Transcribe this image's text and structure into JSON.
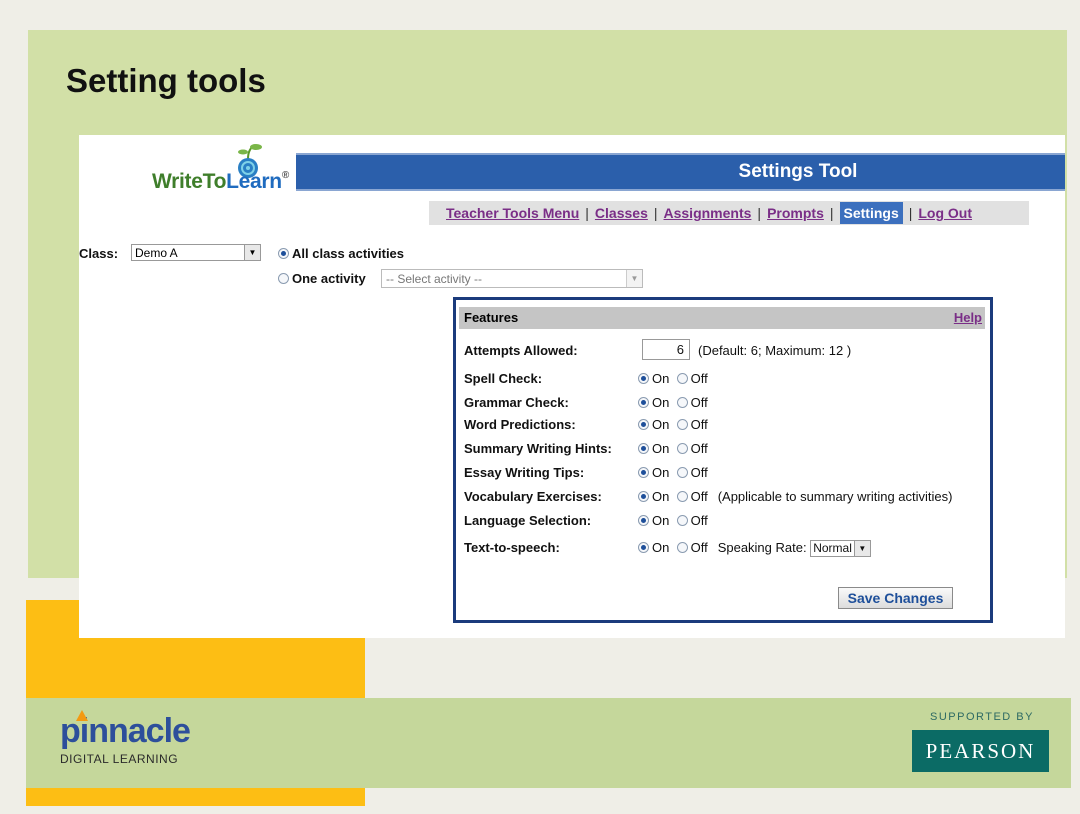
{
  "slide": {
    "title": "Setting tools"
  },
  "app": {
    "logo_prefix": "WriteTo",
    "logo_accent": "Learn",
    "logo_reg": "®",
    "page_title": "Settings Tool"
  },
  "nav": {
    "items": [
      "Teacher Tools Menu",
      "Classes",
      "Assignments",
      "Prompts",
      "Settings",
      "Log Out"
    ],
    "active": "Settings",
    "separator": "|"
  },
  "class_row": {
    "label": "Class:",
    "selected": "Demo A",
    "all_activities_label": "All class activities",
    "all_activities_checked": true,
    "one_activity_label": "One activity",
    "one_activity_checked": false,
    "activity_placeholder": "-- Select activity --"
  },
  "features": {
    "title": "Features",
    "help": "Help",
    "attempts": {
      "label": "Attempts Allowed:",
      "value": "6",
      "note": "(Default: 6; Maximum: 12 )"
    },
    "on_label": "On",
    "off_label": "Off",
    "toggles": [
      {
        "label": "Spell Check:",
        "state": "On"
      },
      {
        "label": "Grammar Check:",
        "state": "On"
      },
      {
        "label": "Word Predictions:",
        "state": "On"
      },
      {
        "label": "Summary Writing Hints:",
        "state": "On"
      },
      {
        "label": "Essay Writing Tips:",
        "state": "On"
      },
      {
        "label": "Vocabulary Exercises:",
        "state": "On",
        "note": "(Applicable to summary writing activities)"
      },
      {
        "label": "Language Selection:",
        "state": "On"
      },
      {
        "label": "Text-to-speech:",
        "state": "On",
        "rate_label": "Speaking Rate:",
        "rate_value": "Normal"
      }
    ],
    "save_label": "Save Changes"
  },
  "footer": {
    "brand": "pinnacle",
    "brand_sub": "DIGITAL LEARNING",
    "supported_by": "SUPPORTED BY",
    "partner": "PEARSON"
  },
  "colors": {
    "green_top": "#d2e0a7",
    "yellow": "#fdbe14",
    "green_bottom": "#c5d79b",
    "title_bar": "#2b5fab",
    "link_purple": "#7a2e87",
    "pearson_teal": "#0b6b65"
  }
}
